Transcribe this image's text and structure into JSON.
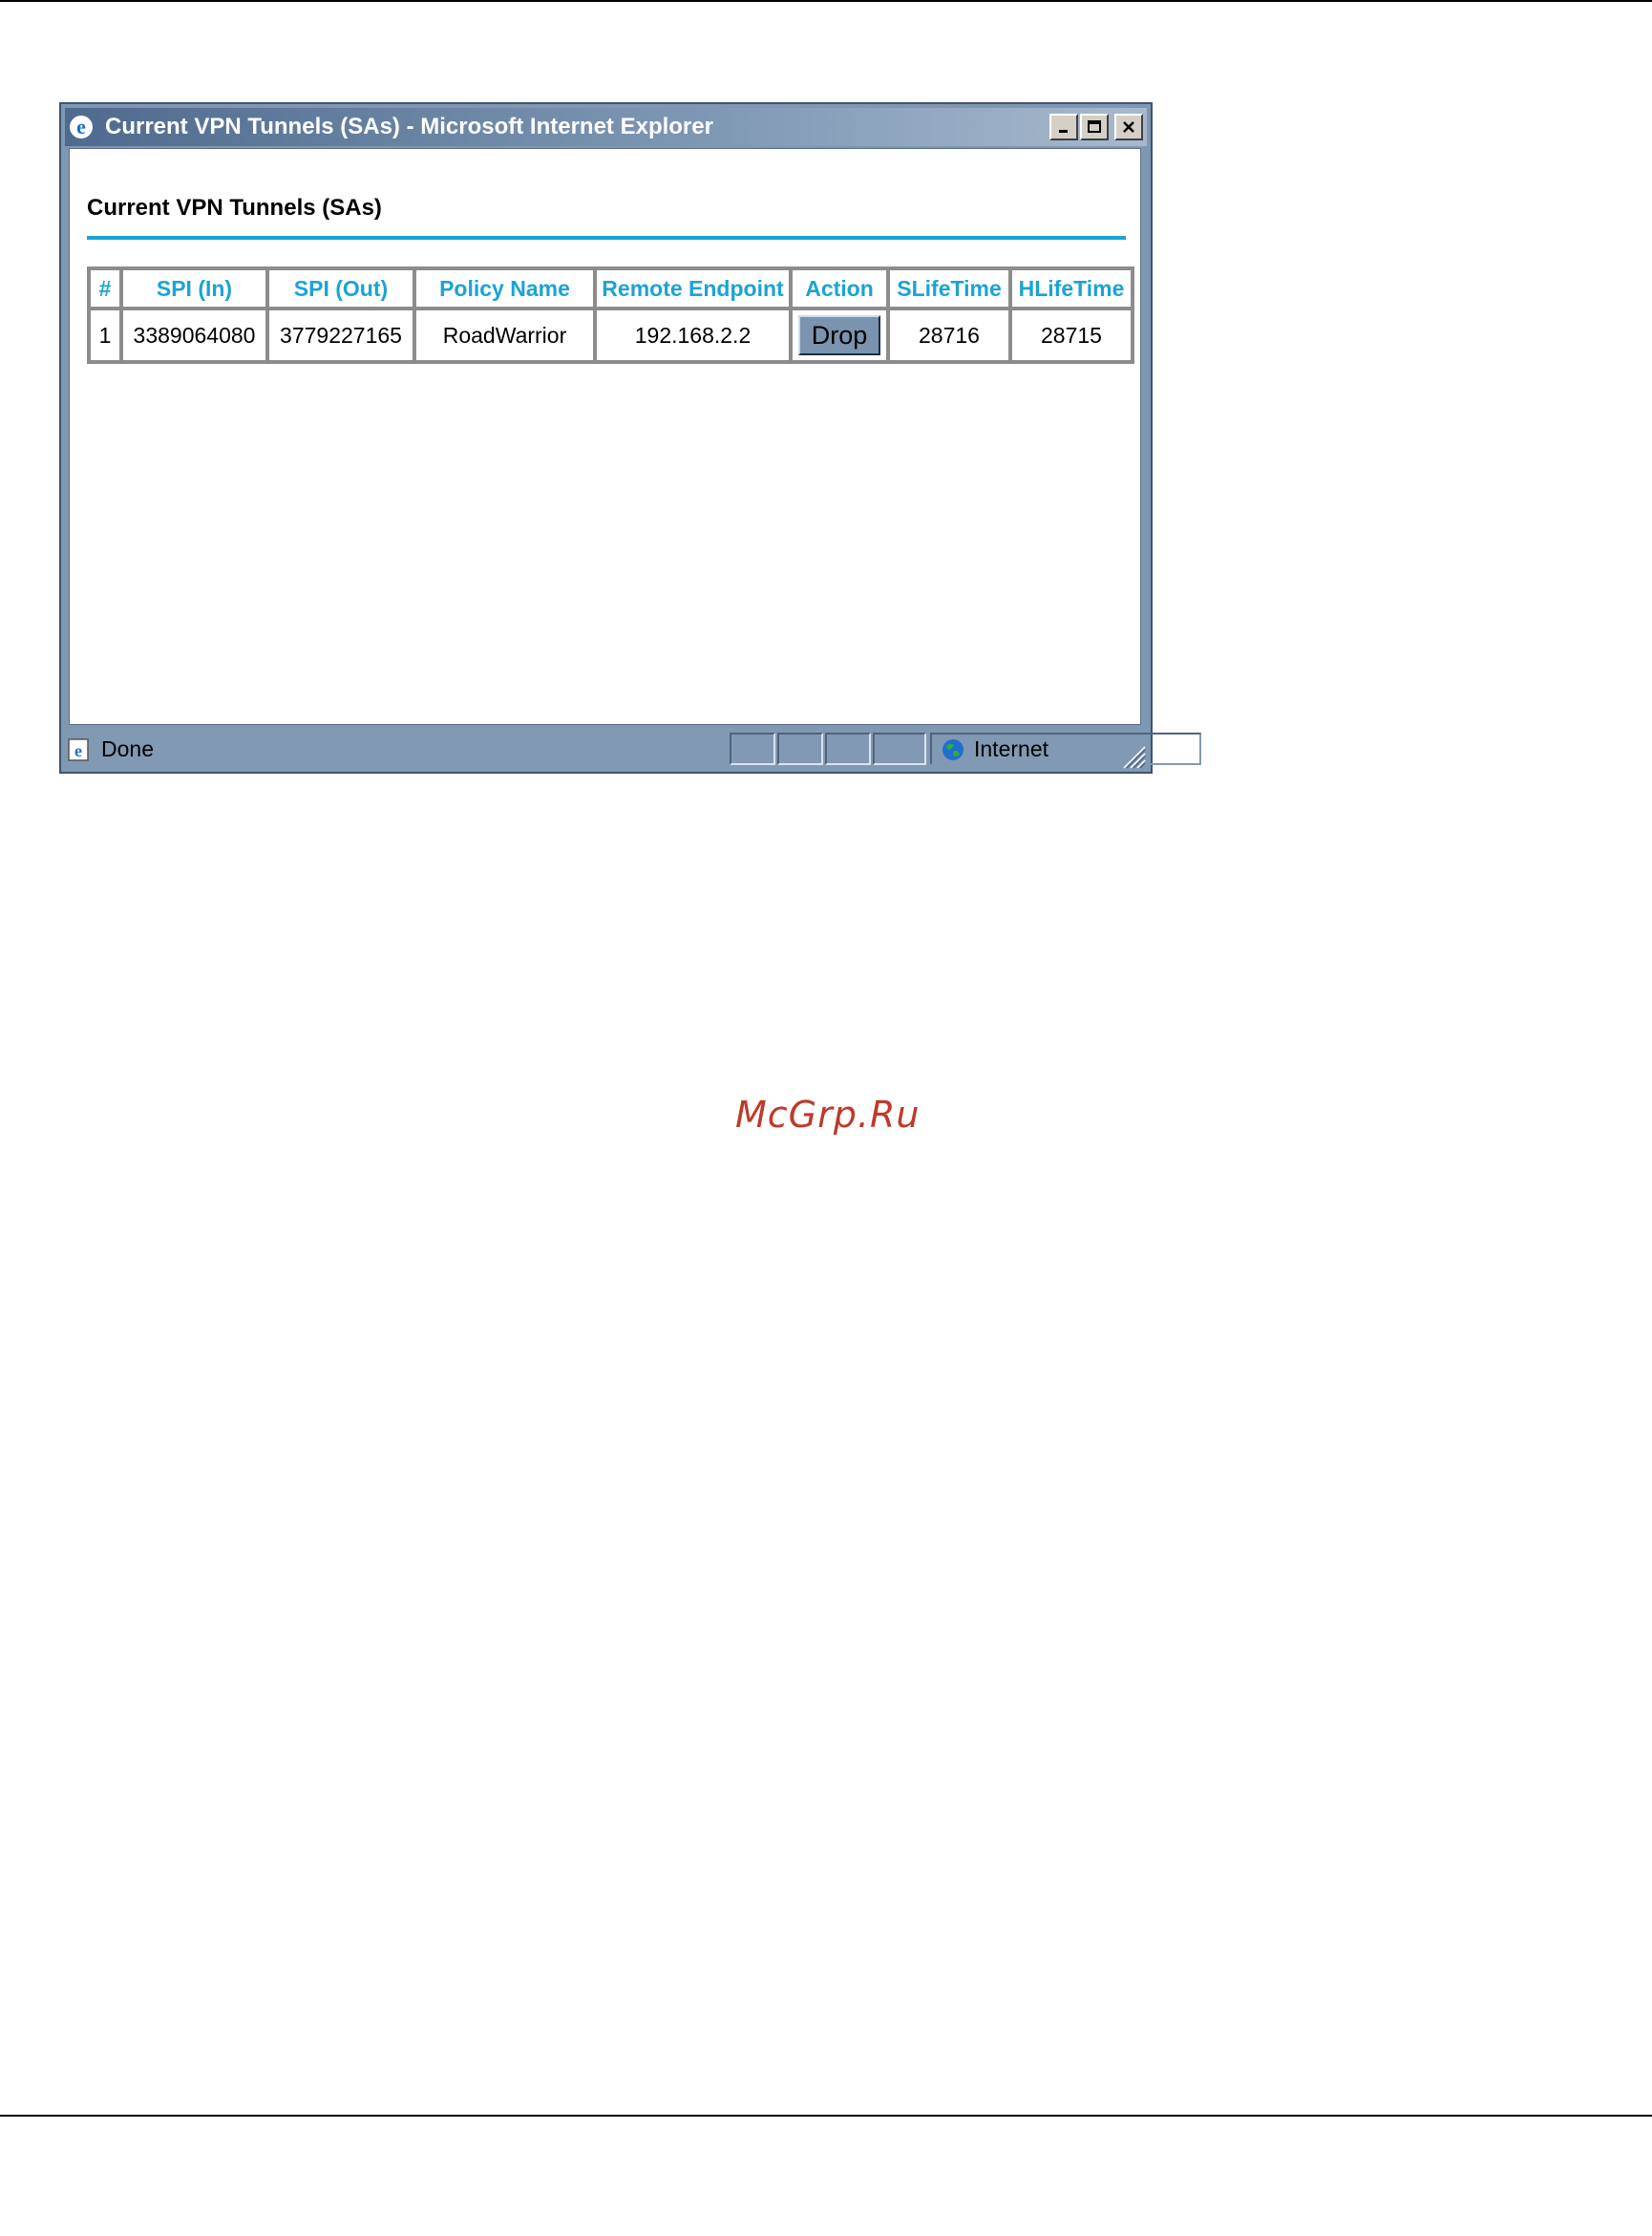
{
  "window": {
    "title": "Current VPN Tunnels (SAs) - Microsoft Internet Explorer",
    "controls": [
      "minimize",
      "maximize",
      "close"
    ]
  },
  "page": {
    "heading": "Current VPN Tunnels (SAs)"
  },
  "table": {
    "headers": [
      "#",
      "SPI (In)",
      "SPI (Out)",
      "Policy Name",
      "Remote Endpoint",
      "Action",
      "SLifeTime",
      "HLifeTime"
    ],
    "rows": [
      {
        "num": "1",
        "spi_in": "3389064080",
        "spi_out": "3779227165",
        "policy_name": "RoadWarrior",
        "remote_endpoint": "192.168.2.2",
        "action": "Drop",
        "slifetime": "28716",
        "hlifetime": "28715"
      }
    ]
  },
  "status_bar": {
    "status": "Done",
    "zone": "Internet"
  },
  "watermark": "McGrp.Ru",
  "colors": {
    "accent": "#1ba3d4",
    "window_frame": "#7f98b2",
    "watermark": "#c0392b"
  }
}
